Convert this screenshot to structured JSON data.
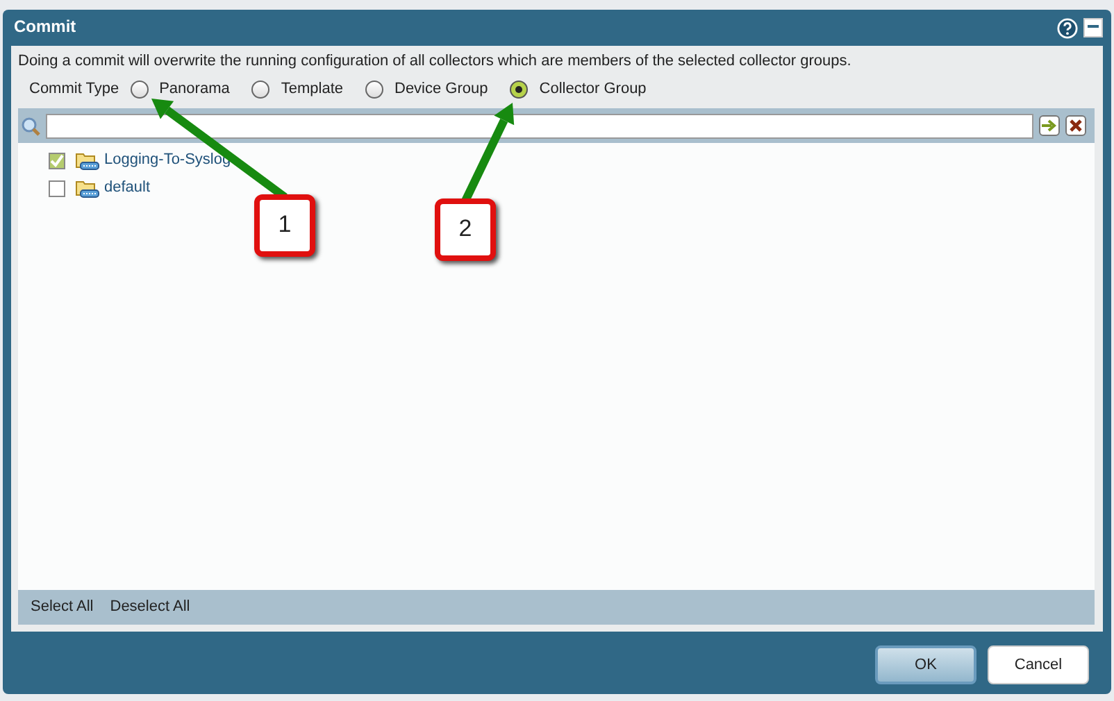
{
  "window": {
    "title": "Commit"
  },
  "description": "Doing a commit will overwrite the running configuration of all collectors which are members of the selected collector groups.",
  "commit_type": {
    "label": "Commit Type",
    "options": [
      {
        "label": "Panorama",
        "selected": false
      },
      {
        "label": "Template",
        "selected": false
      },
      {
        "label": "Device Group",
        "selected": false
      },
      {
        "label": "Collector Group",
        "selected": true
      }
    ]
  },
  "tree": {
    "items": [
      {
        "label": "Logging-To-Syslog",
        "checked": true
      },
      {
        "label": "default",
        "checked": false
      }
    ]
  },
  "footer_links": [
    "Select All",
    "Deselect All"
  ],
  "buttons": [
    {
      "label": "OK",
      "kind": "primary"
    },
    {
      "label": "Cancel",
      "kind": "secondary"
    }
  ],
  "callouts": [
    {
      "number": "1"
    },
    {
      "number": "2"
    }
  ]
}
